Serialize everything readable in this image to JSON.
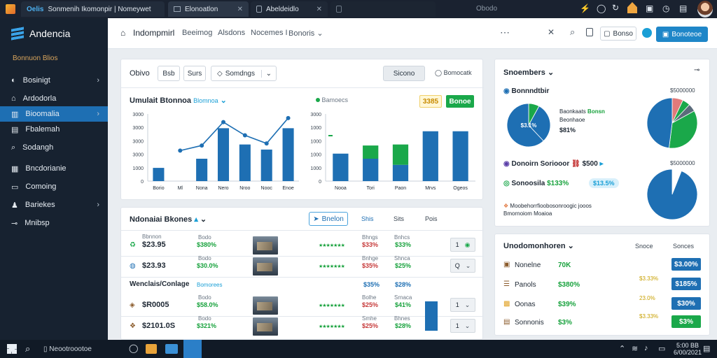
{
  "browser": {
    "tabs": [
      {
        "title": "Sonmenih Ikomonpir | Nomeywet",
        "brand": "Oelis"
      },
      {
        "title": "Elonoatlon"
      },
      {
        "title": "Abeldeidlo"
      },
      {
        "title": ""
      }
    ],
    "center_text": "Obodo"
  },
  "sidebar": {
    "app_name": "Andencia",
    "section": "Bonnuon Blios",
    "items": [
      {
        "label": "Bosinigt",
        "icon": "gauge-icon",
        "chevron": true
      },
      {
        "label": "Ardodorla",
        "icon": "home-icon",
        "chevron": false
      },
      {
        "label": "Bioomalia",
        "icon": "chart-icon",
        "chevron": true,
        "active": true
      },
      {
        "label": "Fbalemah",
        "icon": "document-icon",
        "chevron": false
      },
      {
        "label": "Sodangh",
        "icon": "search-icon",
        "chevron": false
      },
      {
        "label": "Bncdorianie",
        "icon": "grid-icon",
        "chevron": false
      },
      {
        "label": "Comoing",
        "icon": "monitor-icon",
        "chevron": false
      },
      {
        "label": "Bariekes",
        "icon": "users-icon",
        "chevron": true
      },
      {
        "label": "Mnibsp",
        "icon": "pin-icon",
        "chevron": false
      }
    ]
  },
  "header": {
    "title": "Indompmirl",
    "nav": [
      "Beeimog",
      "Alsdons",
      "Nocemes I",
      "Bonoris"
    ],
    "button_small": "Bonso",
    "button_primary": "Bonoteoe"
  },
  "chart_panel": {
    "toolbar": {
      "label": "Obivo",
      "btn1": "Bsb",
      "btn2": "Surs",
      "dropdown": "Somdngs",
      "right_btn": "Sicono",
      "right_link": "Bomocatk"
    },
    "left_title": "Umulait Btonnoa",
    "left_subtitle": "Blomnoa",
    "right_legend": "Bamoecs",
    "right_badge1": "3385",
    "right_badge2": "Bonoe"
  },
  "chart_data": [
    {
      "type": "bar",
      "categories": [
        "Borio",
        "Ml",
        "Nona",
        "Nero",
        "Nroo",
        "Nooc",
        "Enoe"
      ],
      "values": [
        650,
        1100,
        2600,
        1800,
        1550,
        2600
      ],
      "line_values": [
        null,
        1500,
        1750,
        2900,
        2250,
        1850,
        3100
      ],
      "yticks": [
        "0",
        "1000",
        "3000",
        "3000",
        "3000",
        "3000"
      ],
      "ylim": [
        0,
        3300
      ]
    },
    {
      "type": "bar",
      "categories": [
        "Nooa",
        "Tori",
        "Paon",
        "Mrvs",
        "Ogeos"
      ],
      "series": [
        {
          "values": [
            1350,
            1100,
            800,
            2450,
            2450
          ],
          "color": "#1e6fb3"
        },
        {
          "values": [
            0,
            650,
            1000,
            0,
            0
          ],
          "color": "#1aa84a"
        }
      ],
      "yticks": [
        "0",
        "1000",
        "1000",
        "1000",
        "1000",
        "3000"
      ],
      "ylim": [
        0,
        3300
      ]
    }
  ],
  "table_panel": {
    "title": "Ndonaiai Bkones",
    "tabs": [
      "Bnelon",
      "Shis",
      "Sits",
      "Pois"
    ],
    "group_label": "Wenclais/Conlage",
    "group_sub": "Bomorees",
    "group_v1": "$35%",
    "group_v2": "$28%",
    "rows": [
      {
        "value": "$23.95",
        "label1": "Bbnnon",
        "pct": "$380%",
        "label2": "Bhngs",
        "pctA": "$33%",
        "label3": "Bnhcs",
        "pctB": "$33%",
        "qty": "1",
        "icon": "recycle-icon"
      },
      {
        "value": "$23.93",
        "label1": "",
        "pct": "$30.0%",
        "label2": "Bnhge",
        "pctA": "$35%",
        "label3": "Shnca",
        "pctB": "$25%",
        "qty": "Q",
        "icon": "globe-icon"
      },
      {
        "value": "$R0005",
        "label1": "",
        "pct": "$58.0%",
        "label2": "Bolhe",
        "pctA": "$25%",
        "label3": "Srnaca",
        "pctB": "$41%",
        "qty": "1",
        "icon": "coin-icon"
      },
      {
        "value": "$2101.0S",
        "label1": "",
        "pct": "$321%",
        "label2": "Smhe",
        "pctA": "$25%",
        "label3": "Bhnes",
        "pctB": "$28%",
        "qty": "1",
        "icon": "tag-icon"
      }
    ]
  },
  "segments_panel": {
    "title": "Snoembers",
    "item1": {
      "title": "Bonnndtbir",
      "right": "$5000000",
      "pct": "$1.1%",
      "legend1": "Baonkaats",
      "legend2": "Beonhaoe",
      "legend3": "$81%",
      "legend_val": "Bonsn"
    },
    "item2": {
      "title": "Donoirn Soriooor",
      "value": "$500"
    },
    "item2_right": "$5000000",
    "item3": {
      "title": "Sonoosila",
      "v1": "$133%",
      "v2": "$13.5%"
    },
    "item4": {
      "text": "Moobehorrfioobosonroogic jooos Bmornoiom Moaioa"
    }
  },
  "pies": [
    {
      "slices": [
        0.08,
        0.3,
        0.62
      ],
      "colors": [
        "#1aa84a",
        "#1e6fb3",
        "#1e6fb3"
      ],
      "center": "$3.1%"
    },
    {
      "slices": [
        0.07,
        0.05,
        0.05,
        0.35,
        0.48
      ],
      "colors": [
        "#e07a7a",
        "#1aa84a",
        "#5b6b7b",
        "#1aa84a",
        "#1e6fb3"
      ]
    },
    {
      "slices": [
        0.06,
        0.94
      ],
      "colors": [
        "#ffffff",
        "#1e6fb3"
      ]
    }
  ],
  "uncommon_panel": {
    "title": "Unodomonhoren",
    "col1": "Snoce",
    "col2": "Sonces",
    "rows": [
      {
        "label": "Nonelne",
        "v1": "70K",
        "v2": "$3.00%",
        "badge_color": "#1e6fb3",
        "icon": "wallet-icon"
      },
      {
        "label": "Panols",
        "v1": "$380%",
        "v2": "$185%",
        "small": "$3.33%",
        "badge_color": "#1e6fb3",
        "icon": "list-icon"
      },
      {
        "label": "Oonas",
        "v1": "$39%",
        "v2": "$30%",
        "small": "23.0%",
        "badge_color": "#1e6fb3",
        "icon": "box-icon"
      },
      {
        "label": "Sonnonis",
        "v1": "$3%",
        "v2": "$3%",
        "small": "$3.33%",
        "badge_color": "#1aa84a",
        "icon": "receipt-icon"
      }
    ]
  },
  "taskbar": {
    "search_label": "Neootroootoe",
    "time": "5:00 BB",
    "date": "6/00/2021"
  }
}
